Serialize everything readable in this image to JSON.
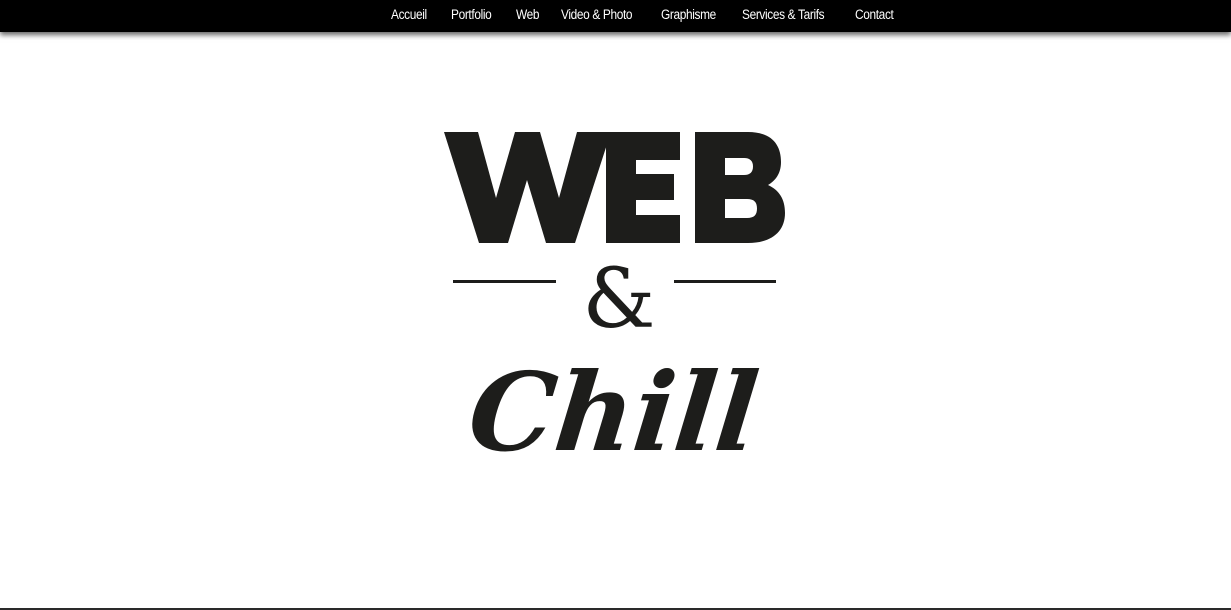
{
  "nav": {
    "items": [
      {
        "label": "Accueil"
      },
      {
        "label": "Portfolio"
      },
      {
        "label": "Web"
      },
      {
        "label": "Video & Photo"
      },
      {
        "label": "Graphisme"
      },
      {
        "label": "Services & Tarifs"
      },
      {
        "label": "Contact"
      }
    ]
  },
  "logo": {
    "line1": "WEB",
    "ampersand": "&",
    "line2": "Chill"
  },
  "colors": {
    "nav_background": "#000000",
    "nav_text": "#ffffff",
    "logo_ink": "#1d1d1b",
    "page_background": "#ffffff"
  }
}
